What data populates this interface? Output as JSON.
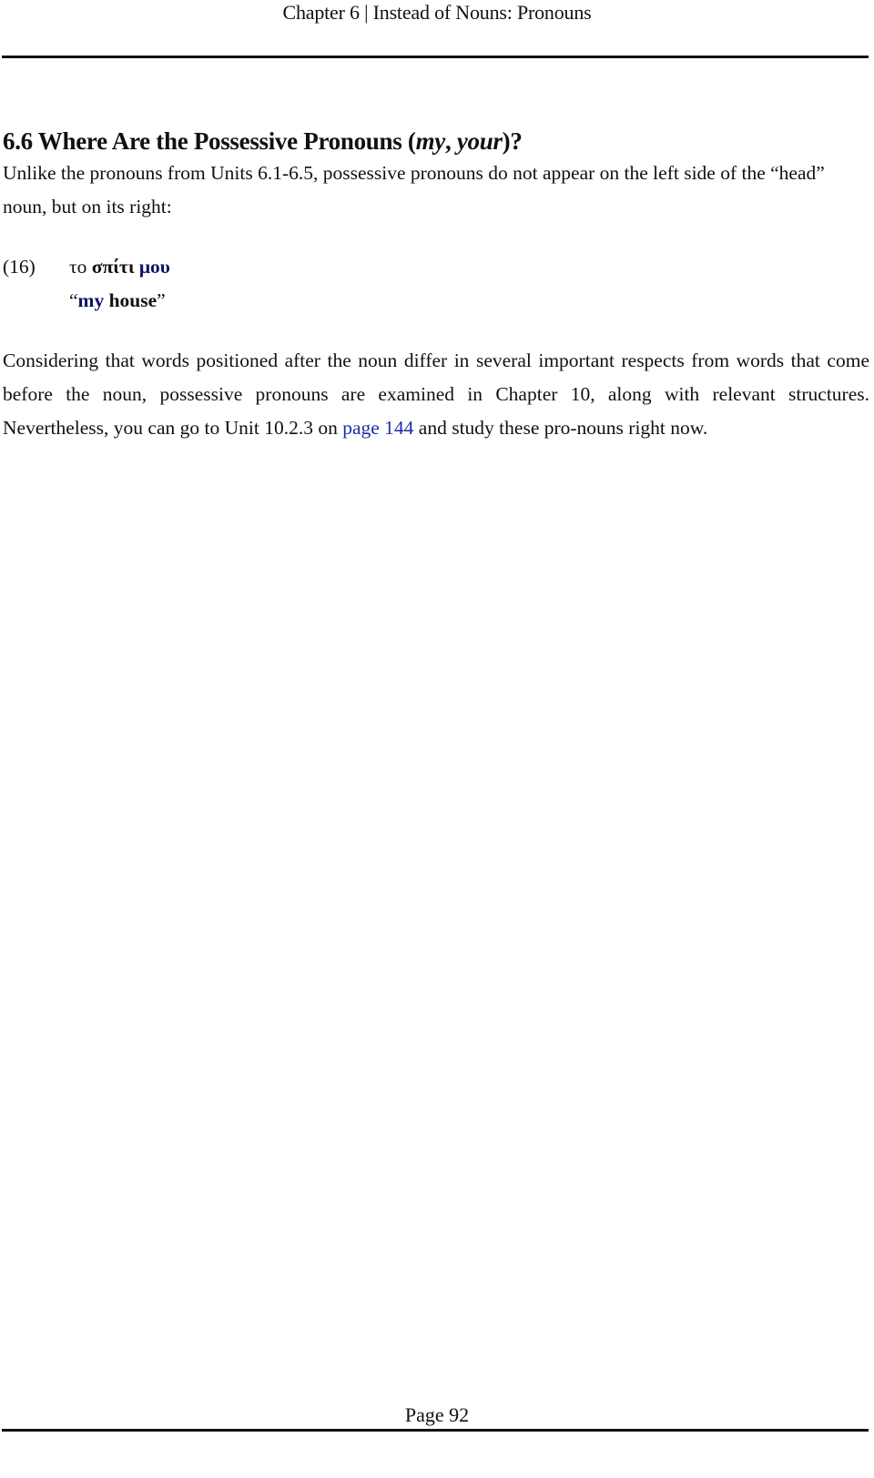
{
  "header": {
    "running_title": "Chapter 6 | Instead of Nouns: Pronouns"
  },
  "section": {
    "heading_prefix": "6.6 Where Are the Possessive Pronouns (",
    "heading_em1": "my",
    "heading_sep": ", ",
    "heading_em2": "your",
    "heading_suffix": ")?",
    "intro": "Unlike the pronouns from Units 6.1-6.5, possessive pronouns do not appear on the left side of the “head” noun, but on its right:"
  },
  "example": {
    "number": "(16)",
    "greek_article": "το ",
    "greek_noun": "σπίτι",
    "greek_space": " ",
    "greek_pronoun": "μου",
    "open_quote": "“",
    "translation_pronoun": "my",
    "translation_rest": " house",
    "close_quote": "”"
  },
  "body": {
    "text_before_link": "Considering that words positioned after the noun differ in several important respects from words that come before the noun, possessive pronouns are examined in Chapter 10, along with relevant structures. Nevertheless, you can go to Unit 10.2.3 on ",
    "link_text": "page 144",
    "text_after_link": " and study these pro-nouns right now."
  },
  "footer": {
    "page_label": "Page 92"
  },
  "colors": {
    "text": "#111111",
    "highlight_blue": "#0a1466",
    "link_blue": "#1a2dab"
  }
}
